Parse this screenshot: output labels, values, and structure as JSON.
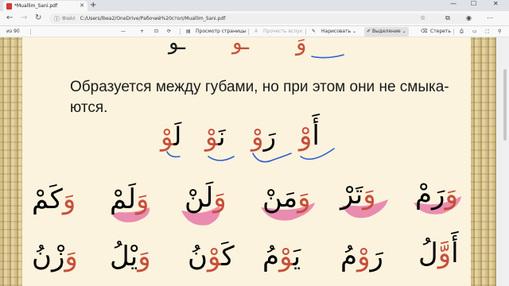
{
  "browser": {
    "tab_title": "*Muallim_Sani.pdf",
    "tab_close": "✕",
    "new_tab": "+",
    "win_min": "—",
    "win_max": "☐",
    "win_close": "✕",
    "back": "←",
    "forward": "→",
    "refresh": "↻",
    "url_label": "Файл",
    "url": "C:/Users/lbea2/OneDrive/Рабочий%20стол/Muallim_Sani.pdf"
  },
  "pdf_toolbar": {
    "page_count": "из 90",
    "zoom_out": "—",
    "zoom_in": "+",
    "page_view": "Просмотр страницы",
    "read_aloud": "Прочесть вслух",
    "draw": "Нарисовать",
    "highlight": "Выделение",
    "erase": "Стереть"
  },
  "page": {
    "top_row": [
      {
        "text": "وَ",
        "label": "وَ"
      },
      {
        "text": "ـو",
        "label": "ـو"
      },
      {
        "text": "ـو",
        "label": "ـو"
      }
    ],
    "text": "Образуется между губами, но при этом они не смыка-ются.",
    "line1": "Образуется между губами, но при этом они не смыка-",
    "line2": "ются.",
    "middle_row": [
      "أَوْ",
      "رَوْ",
      "نَوْ",
      "لَوْ"
    ],
    "row3": [
      "وَرَمْ",
      "وَتَرْ",
      "وَمَنْ",
      "وَلَنْ",
      "وَلَمْ",
      "وَكَمْ"
    ],
    "row4": [
      "أَوَّلُ",
      "رَوْمُ",
      "يَوْمُ",
      "كَوْنُ",
      "وَيْلُ",
      "وَزْنُ"
    ]
  },
  "colors": {
    "pen_blue": "#2f5fd0",
    "pen_pink": "#e87aa8",
    "letter_red": "#c7503a",
    "page_bg": "#fbf3de"
  }
}
